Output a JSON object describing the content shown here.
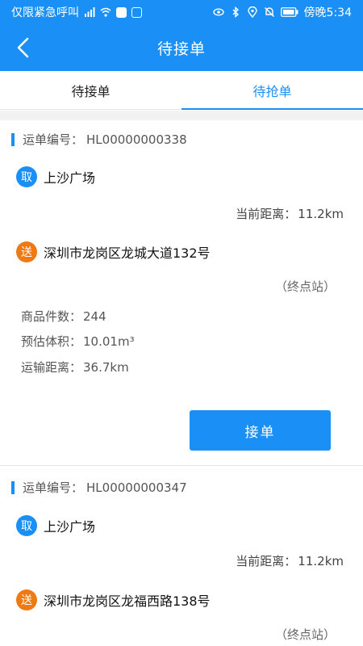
{
  "status_bar": {
    "carrier": "仅限紧急呼叫",
    "time": "傍晚5:34",
    "icons": [
      "signal-icon",
      "wifi-icon",
      "shield-icon",
      "app-icon",
      "eye-icon",
      "bluetooth-icon",
      "location-icon",
      "mute-icon",
      "battery-icon"
    ]
  },
  "header": {
    "title": "待接单",
    "back_icon": "chevron-left-icon"
  },
  "tabs": [
    {
      "label": "待接单",
      "active": false
    },
    {
      "label": "待抢单",
      "active": true
    }
  ],
  "colors": {
    "primary": "#1a8ff5",
    "pickup_badge": "#1a8ff5",
    "deliver_badge": "#f07a12",
    "background_gap": "#f2f2f2"
  },
  "labels": {
    "order_no": "运单编号：",
    "pickup_badge": "取",
    "deliver_badge": "送",
    "distance": "当前距离：",
    "terminal": "（终点站）",
    "goods_count": "商品件数：",
    "volume": "预估体积：",
    "transport_distance": "运输距离：",
    "accept": "接单"
  },
  "orders": [
    {
      "order_no": "HL00000000338",
      "pickup": "上沙广场",
      "current_distance": "11.2km",
      "destination": "深圳市龙岗区龙城大道132号",
      "goods_count": "244",
      "volume": "10.01m³",
      "transport_distance": "36.7km"
    },
    {
      "order_no": "HL00000000347",
      "pickup": "上沙广场",
      "current_distance": "11.2km",
      "destination": "深圳市龙岗区龙福西路138号"
    }
  ]
}
